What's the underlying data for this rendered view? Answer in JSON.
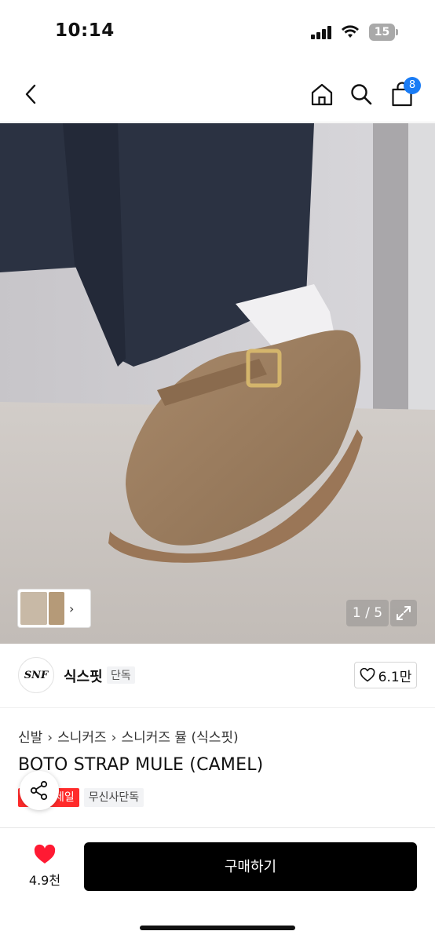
{
  "status_bar": {
    "time": "10:14",
    "battery": "15"
  },
  "header": {
    "cart_count": "8"
  },
  "gallery": {
    "counter": "1 / 5"
  },
  "brand": {
    "logo_text": "SNF",
    "name": "식스핏",
    "tag": "단독",
    "likes": "6.1만"
  },
  "breadcrumb": [
    "신발",
    "스니커즈",
    "스니커즈 뮬 (식스핏)"
  ],
  "product": {
    "title": "BOTO STRAP MULE (CAMEL)",
    "badge_sale": "세일",
    "badge_exclusive": "무신사단독"
  },
  "bottom_bar": {
    "wish_count": "4.9천",
    "buy_label": "구매하기"
  },
  "colors": {
    "cart_badge": "#1a7cf5",
    "sale_badge": "#ff2b2b",
    "wish_heart": "#ff1a33",
    "buy_button": "#000000"
  }
}
